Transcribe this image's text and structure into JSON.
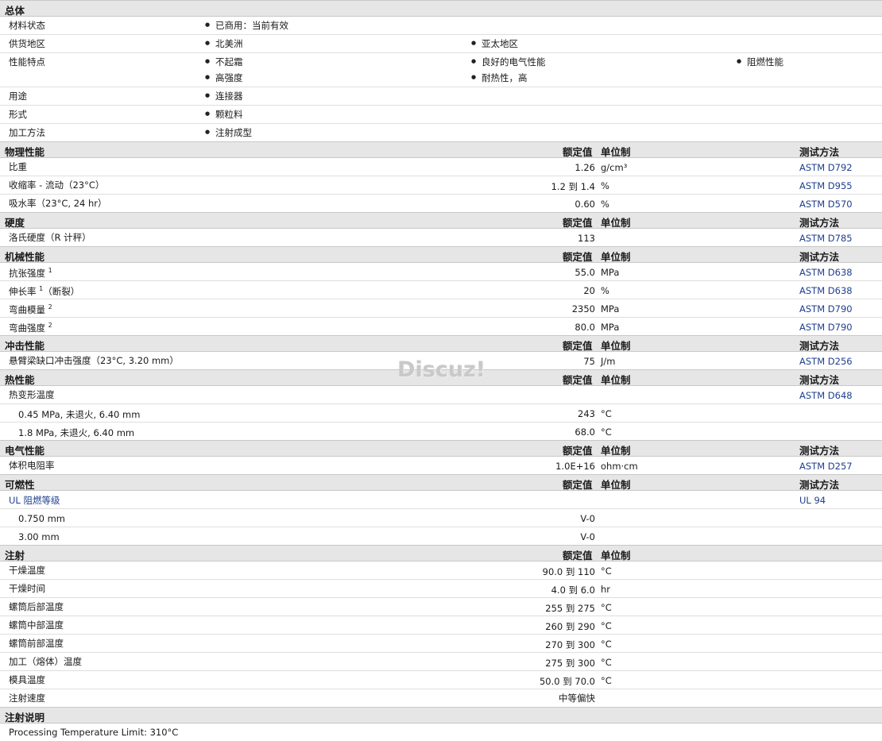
{
  "general": {
    "title": "总体",
    "status_label": "材料状态",
    "status_value": "已商用：当前有效",
    "region_label": "供货地区",
    "regions": [
      "北美洲",
      "亚太地区"
    ],
    "features_label": "性能特点",
    "features": [
      "不起霜",
      "良好的电气性能",
      "阻燃性能",
      "高强度",
      "耐热性，高"
    ],
    "use_label": "用途",
    "use_value": "连接器",
    "form_label": "形式",
    "form_value": "颗粒料",
    "process_label": "加工方法",
    "process_value": "注射成型"
  },
  "columns": {
    "value": "额定值",
    "unit": "单位制",
    "method": "测试方法"
  },
  "physical": {
    "title": "物理性能",
    "rows": [
      {
        "label": "比重",
        "value": "1.26",
        "unit": "g/cm³",
        "method": "ASTM D792"
      },
      {
        "label": "收缩率 - 流动（23°C）",
        "value": "1.2 到  1.4",
        "unit": "%",
        "method": "ASTM D955"
      },
      {
        "label": "吸水率（23°C, 24 hr）",
        "value": "0.60",
        "unit": "%",
        "method": "ASTM D570"
      }
    ]
  },
  "hardness": {
    "title": "硬度",
    "rows": [
      {
        "label": "洛氏硬度（R 计秤）",
        "value": "113",
        "unit": "",
        "method": "ASTM D785"
      }
    ]
  },
  "mechanical": {
    "title": "机械性能",
    "rows": [
      {
        "label": "抗张强度",
        "sup": "1",
        "suffix": "",
        "value": "55.0",
        "unit": "MPa",
        "method": "ASTM D638"
      },
      {
        "label": "伸长率",
        "sup": "1",
        "suffix": "（断裂）",
        "value": "20",
        "unit": "%",
        "method": "ASTM D638"
      },
      {
        "label": "弯曲模量",
        "sup": "2",
        "suffix": "",
        "value": "2350",
        "unit": "MPa",
        "method": "ASTM D790"
      },
      {
        "label": "弯曲强度",
        "sup": "2",
        "suffix": "",
        "value": "80.0",
        "unit": "MPa",
        "method": "ASTM D790"
      }
    ]
  },
  "impact": {
    "title": "冲击性能",
    "rows": [
      {
        "label": "悬臂梁缺口冲击强度（23°C, 3.20 mm）",
        "value": "75",
        "unit": "J/m",
        "method": "ASTM D256"
      }
    ]
  },
  "thermal": {
    "title": "热性能",
    "main_label": "热变形温度",
    "main_method": "ASTM D648",
    "rows": [
      {
        "label": "0.45 MPa, 未退火, 6.40 mm",
        "value": "243",
        "unit": "°C"
      },
      {
        "label": "1.8 MPa, 未退火, 6.40 mm",
        "value": "68.0",
        "unit": "°C"
      }
    ]
  },
  "electrical": {
    "title": "电气性能",
    "rows": [
      {
        "label": "体积电阻率",
        "value": "1.0E+16",
        "unit": "ohm·cm",
        "method": "ASTM D257"
      }
    ]
  },
  "flammability": {
    "title": "可燃性",
    "main_label": "UL 阻燃等级",
    "main_method": "UL 94",
    "rows": [
      {
        "label": "0.750 mm",
        "value": "V-0"
      },
      {
        "label": "3.00 mm",
        "value": "V-0"
      }
    ]
  },
  "injection": {
    "title": "注射",
    "rows": [
      {
        "label": "干燥温度",
        "value": "90.0 到  110",
        "unit": "°C"
      },
      {
        "label": "干燥时间",
        "value": "4.0 到  6.0",
        "unit": "hr"
      },
      {
        "label": "螺筒后部温度",
        "value": "255 到  275",
        "unit": "°C"
      },
      {
        "label": "螺筒中部温度",
        "value": "260 到  290",
        "unit": "°C"
      },
      {
        "label": "螺筒前部温度",
        "value": "270 到  300",
        "unit": "°C"
      },
      {
        "label": "加工（熔体）温度",
        "value": "275 到  300",
        "unit": "°C"
      },
      {
        "label": "模具温度",
        "value": "50.0 到  70.0",
        "unit": "°C"
      },
      {
        "label": "注射速度",
        "value": "中等偏快",
        "unit": ""
      }
    ]
  },
  "notes": {
    "title": "注射说明",
    "text": "Processing Temperature Limit: 310°C"
  },
  "watermark": "Discuz!"
}
